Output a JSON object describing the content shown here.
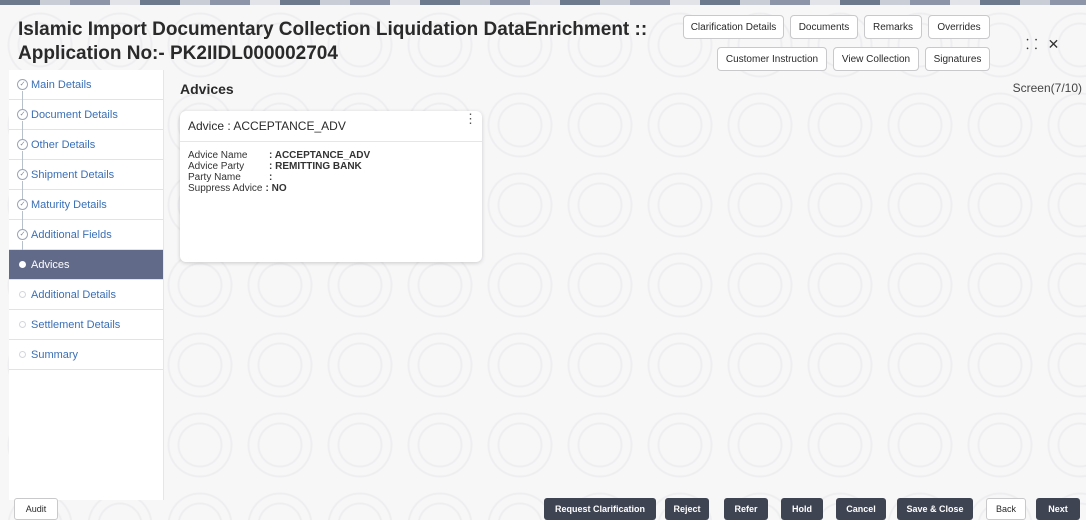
{
  "header": {
    "title_line1": "Islamic Import Documentary Collection Liquidation DataEnrichment ::",
    "title_line2": "Application No:- PK2IIDL000002704",
    "buttons_row1": [
      "Clarification Details",
      "Documents",
      "Remarks",
      "Overrides"
    ],
    "buttons_row2": [
      "Customer Instruction",
      "View Collection",
      "Signatures"
    ],
    "resize_icon": "⸬",
    "close_icon": "✕"
  },
  "sidebar": {
    "items": [
      {
        "label": "Main Details",
        "state": "done"
      },
      {
        "label": "Document Details",
        "state": "done"
      },
      {
        "label": "Other Details",
        "state": "done"
      },
      {
        "label": "Shipment Details",
        "state": "done"
      },
      {
        "label": "Maturity Details",
        "state": "done"
      },
      {
        "label": "Additional Fields",
        "state": "done"
      },
      {
        "label": "Advices",
        "state": "active"
      },
      {
        "label": "Additional Details",
        "state": "pending"
      },
      {
        "label": "Settlement Details",
        "state": "pending"
      },
      {
        "label": "Summary",
        "state": "pending"
      }
    ]
  },
  "main": {
    "title": "Advices",
    "screen": "Screen(7/10)",
    "card": {
      "title": "Advice : ACCEPTANCE_ADV",
      "rows": [
        {
          "key": "Advice Name",
          "value": ": ACCEPTANCE_ADV"
        },
        {
          "key": "Advice Party",
          "value": ": REMITTING BANK"
        },
        {
          "key": "Party Name",
          "value": ":"
        },
        {
          "key": "Suppress Advice",
          "value": ": NO"
        }
      ]
    }
  },
  "footer": {
    "audit": "Audit",
    "request_clarification": "Request Clarification",
    "reject": "Reject",
    "refer": "Refer",
    "hold": "Hold",
    "cancel": "Cancel",
    "save_close": "Save & Close",
    "back": "Back",
    "next": "Next"
  },
  "colors": {
    "active_nav": "#626a8a",
    "link": "#3a6fb5",
    "dark_button": "#3f4453"
  }
}
